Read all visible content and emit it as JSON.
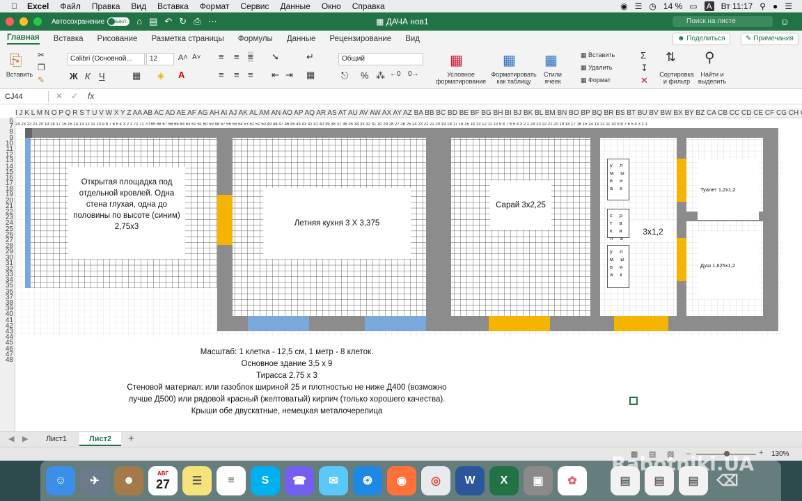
{
  "menubar": {
    "app": "Excel",
    "items": [
      "Файл",
      "Правка",
      "Вид",
      "Вставка",
      "Формат",
      "Сервис",
      "Данные",
      "Окно",
      "Справка"
    ],
    "battery": "14 %",
    "input_lang": "A",
    "clock": "Вт 11:17"
  },
  "titlebar": {
    "autosave_label": "Автосохранение",
    "autosave_state": "выкл.",
    "doc_title": "ДАЧА нов1",
    "search_placeholder": "Поиск на листе"
  },
  "ribbon_tabs": [
    "Главная",
    "Вставка",
    "Рисование",
    "Разметка страницы",
    "Формулы",
    "Данные",
    "Рецензирование",
    "Вид"
  ],
  "share_label": "Поделиться",
  "comments_label": "Примечания",
  "ribbon": {
    "paste": "Вставить",
    "font_name": "Calibri (Основной...",
    "font_size": "12",
    "bold": "Ж",
    "italic": "К",
    "underline": "Ч",
    "number_format": "Общий",
    "percent": "%",
    "cond_format_1": "Условное",
    "cond_format_2": "форматирование",
    "format_table_1": "Форматировать",
    "format_table_2": "как таблицу",
    "styles_1": "Стили",
    "styles_2": "ячеек",
    "insert": "Вставить",
    "delete": "Удалить",
    "format": "Формат",
    "sort_1": "Сортировка",
    "sort_2": "и фильтр",
    "find_1": "Найти и",
    "find_2": "выделить"
  },
  "formula_bar": {
    "name_box": "CJ44",
    "fx": "fx",
    "formula": ""
  },
  "col_headers": "I J K L M N O P Q R S T U V W X Y Z AA AB AC AD AE AF AG AH AI AJ AK AL AM AN AO AP AQ AR AS AT AU AV AW AX AY AZ BA BB BC BD BE BF BG BH BI BJ BK BL BM BN BO BP BQ BR BS BT BU BV BW BX BY BZ CA CB CC CD CE CF CG CH CI CJ CK CL CM CN CO CP CQ CR CS CT CU CV CW CX CY CZ DA DB DC DD DE DF DG",
  "row_headers": [
    "6",
    "7",
    "8",
    "9",
    "10",
    "11",
    "12",
    "13",
    "14",
    "15",
    "16",
    "17",
    "18",
    "19",
    "20",
    "21",
    "22",
    "23",
    "24",
    "25",
    "26",
    "27",
    "28",
    "29",
    "30",
    "31",
    "32",
    "33",
    "34",
    "35",
    "36",
    "37",
    "38",
    "39",
    "40",
    "41",
    "42",
    "43",
    "44",
    "45",
    "46",
    "47",
    "48"
  ],
  "plan": {
    "terrace_text": [
      "Открытая площадка под",
      "отдельной кровлей. Одна",
      "стена глухая, одна до",
      "половины по высоте (синим)",
      "",
      "2,75х3"
    ],
    "kitchen": "Летняя кухня 3 Х 3,375",
    "shed": "Сарай 3х2,25",
    "room": "3х1,2",
    "toilet": "Туалет 1,2х1,2",
    "shower": "Душ 1,625х1,2",
    "box_1": "у л м ы в и а к",
    "box_2": "с р т а к и л а",
    "box_3": "у л м ы в и а к"
  },
  "notes": [
    "Масштаб: 1 клетка - 12,5 см, 1 метр - 8 клеток.",
    "Основное здание 3,5 х 9",
    "Тирасса 2,75 х 3",
    "Стеновой материал: или газоблок шириной 25 и плотностью не ниже Д400 (возможно",
    "лучше Д500) или рядовой красный (желтоватый) кирпич (только хорошего качества).",
    "Крыши обе двускатные, немецкая металочерепица"
  ],
  "sheet_tabs": [
    "Лист1",
    "Лист2"
  ],
  "zoom": "130%",
  "watermark": "Rabotniki.UA",
  "dock_icons": [
    "finder-icon",
    "launchpad-icon",
    "contacts-icon",
    "calendar-icon",
    "notes-icon",
    "reminders-icon",
    "skype-icon",
    "viber-icon",
    "messages-icon",
    "safari-icon",
    "firefox-icon",
    "chrome-icon",
    "word-icon",
    "excel-icon",
    "preview-icon",
    "photos-icon",
    "documents-icon",
    "trash-icon"
  ],
  "calendar": {
    "month": "АВГ",
    "day": "27"
  },
  "colors": {
    "excel_green": "#217346",
    "wall_gray": "#8c8c8c",
    "window_blue": "#7aa7dc",
    "door_yellow": "#f4b400"
  }
}
